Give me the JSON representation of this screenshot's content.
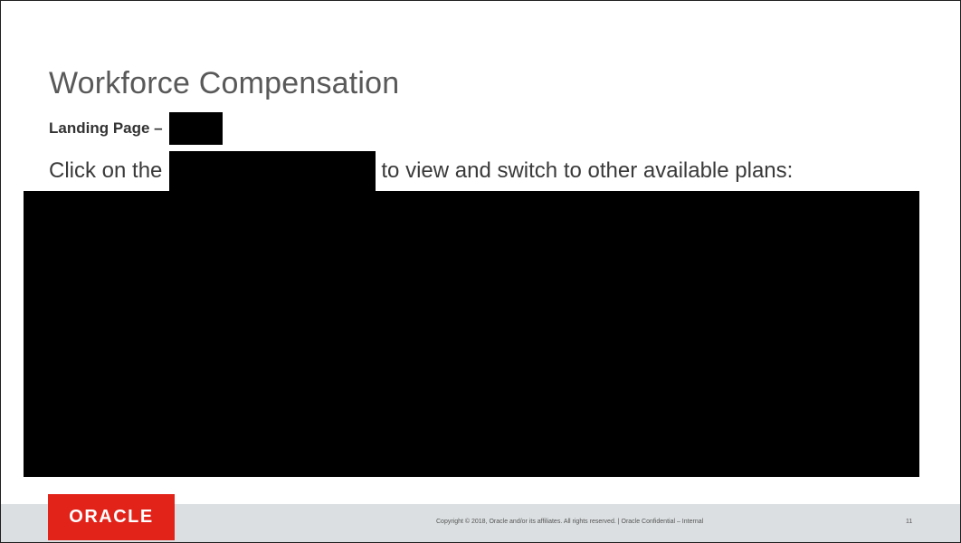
{
  "slide": {
    "title": "Workforce Compensation",
    "subtitle": "Landing Page –",
    "body_prefix": "Click on the",
    "body_suffix": "to view and switch to other available plans:",
    "logo_text": "ORACLE",
    "copyright": "Copyright © 2018, Oracle and/or its affiliates. All rights reserved.  |  Oracle Confidential – Internal",
    "page_number": "11"
  },
  "colors": {
    "brand_red": "#e2231a",
    "footer_bg": "#dbdfe1",
    "redaction": "#000000"
  }
}
